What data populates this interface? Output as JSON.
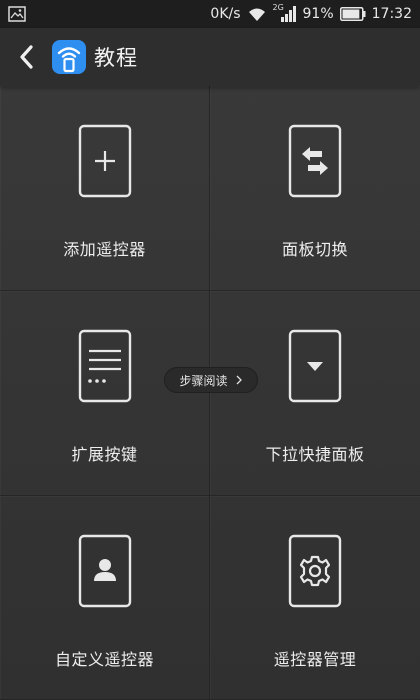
{
  "status_bar": {
    "network_speed": "0K/s",
    "network_type": "2G",
    "battery_percent": "91%",
    "battery_level": 0.91,
    "time": "17:32",
    "icons": [
      "gallery-icon",
      "wifi-icon",
      "signal-icon",
      "battery-icon"
    ]
  },
  "header": {
    "back_icon": "back-arrow-icon",
    "logo_icon": "remote-app-logo-icon",
    "title": "教程"
  },
  "tiles": [
    {
      "label": "添加遥控器",
      "icon": "add-remote-icon"
    },
    {
      "label": "面板切换",
      "icon": "switch-panel-icon"
    },
    {
      "label": "扩展按键",
      "icon": "extend-keys-icon"
    },
    {
      "label": "下拉快捷面板",
      "icon": "dropdown-panel-icon"
    },
    {
      "label": "自定义遥控器",
      "icon": "custom-remote-icon"
    },
    {
      "label": "遥控器管理",
      "icon": "manage-remote-icon"
    }
  ],
  "read_steps": {
    "label": "步骤阅读",
    "icon": "chevron-right-icon"
  },
  "colors": {
    "background": "#333333",
    "status_bar": "#1e1e1e",
    "title_bar": "#2e2e2e",
    "text": "#eeeeee",
    "logo_blue": "#2f8ff0"
  }
}
